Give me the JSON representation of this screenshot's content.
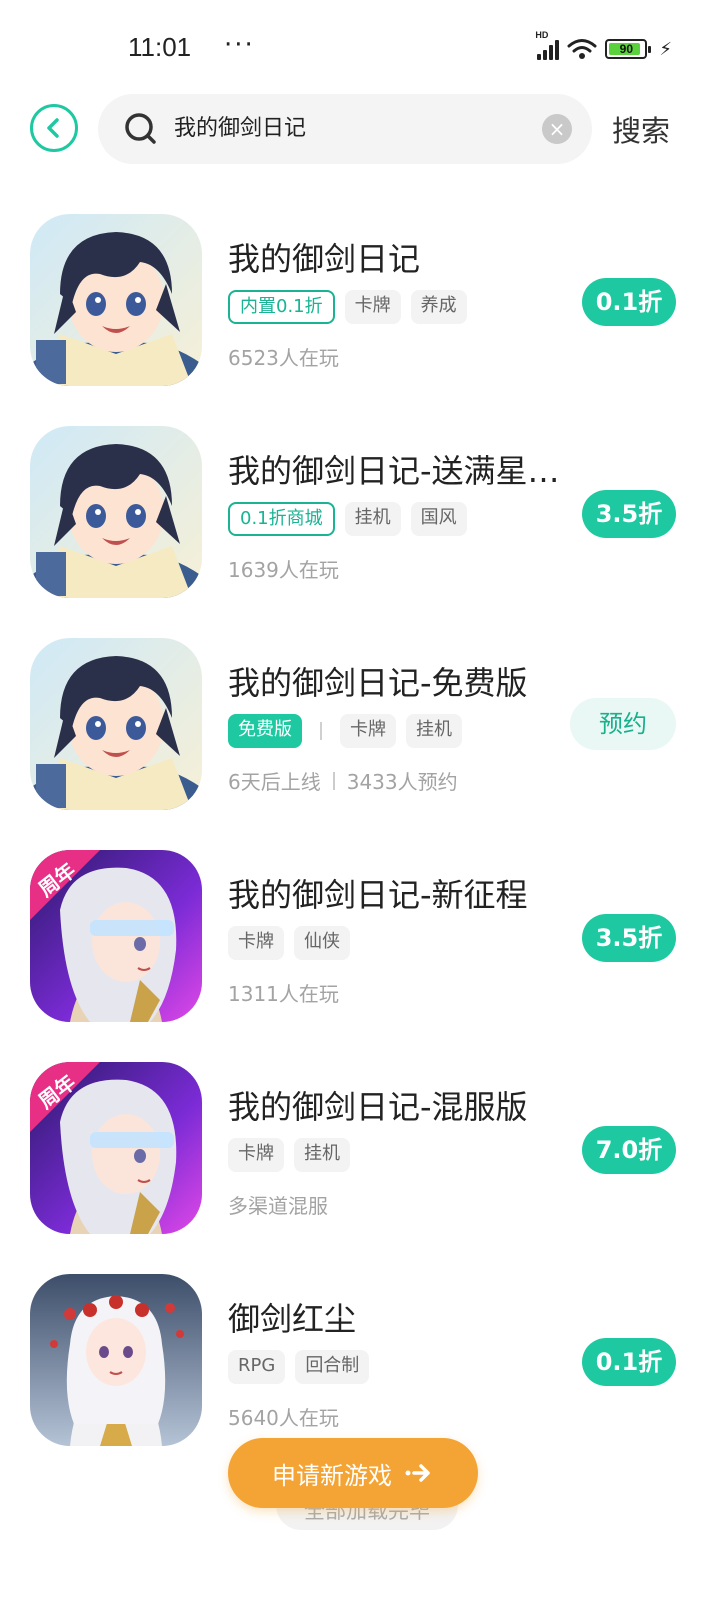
{
  "status": {
    "time": "11:01",
    "dots": "···",
    "signal_label": "HD",
    "battery": "90"
  },
  "search": {
    "query": "我的御剑日记",
    "button_label": "搜索"
  },
  "games": [
    {
      "name": "我的御剑日记",
      "tags": [
        {
          "text": "内置0.1折",
          "style": "outline"
        },
        {
          "text": "卡牌",
          "style": "plain"
        },
        {
          "text": "养成",
          "style": "plain"
        }
      ],
      "meta": [
        "6523人在玩"
      ],
      "action": {
        "type": "discount",
        "label": "0.1折"
      },
      "art": "anime-boy"
    },
    {
      "name": "我的御剑日记-送满星…",
      "tags": [
        {
          "text": "0.1折商城",
          "style": "outline"
        },
        {
          "text": "挂机",
          "style": "plain"
        },
        {
          "text": "国风",
          "style": "plain"
        }
      ],
      "meta": [
        "1639人在玩"
      ],
      "action": {
        "type": "discount",
        "label": "3.5折"
      },
      "art": "anime-boy"
    },
    {
      "name": "我的御剑日记-免费版",
      "tags": [
        {
          "text": "免费版",
          "style": "filled"
        },
        {
          "text": "|",
          "style": "sep"
        },
        {
          "text": "卡牌",
          "style": "plain"
        },
        {
          "text": "挂机",
          "style": "plain"
        }
      ],
      "meta": [
        "6天后上线",
        "3433人预约"
      ],
      "action": {
        "type": "reserve",
        "label": "预约"
      },
      "art": "anime-boy"
    },
    {
      "name": "我的御剑日记-新征程",
      "tags": [
        {
          "text": "卡牌",
          "style": "plain"
        },
        {
          "text": "仙侠",
          "style": "plain"
        }
      ],
      "meta": [
        "1311人在玩"
      ],
      "action": {
        "type": "discount",
        "label": "3.5折"
      },
      "art": "anniversary-girl",
      "badge": "周年"
    },
    {
      "name": "我的御剑日记-混服版",
      "tags": [
        {
          "text": "卡牌",
          "style": "plain"
        },
        {
          "text": "挂机",
          "style": "plain"
        }
      ],
      "meta": [
        "多渠道混服"
      ],
      "action": {
        "type": "discount",
        "label": "7.0折"
      },
      "art": "anniversary-girl",
      "badge": "周年"
    },
    {
      "name": "御剑红尘",
      "tags": [
        {
          "text": "RPG",
          "style": "plain"
        },
        {
          "text": "回合制",
          "style": "plain"
        }
      ],
      "meta": [
        "5640人在玩"
      ],
      "action": {
        "type": "discount",
        "label": "0.1折"
      },
      "art": "white-hair-girl"
    }
  ],
  "footer": {
    "load_more": "全部加载完毕",
    "apply_button": "申请新游戏"
  },
  "colors": {
    "accent": "#1ec9a2",
    "orange": "#f4a434"
  }
}
